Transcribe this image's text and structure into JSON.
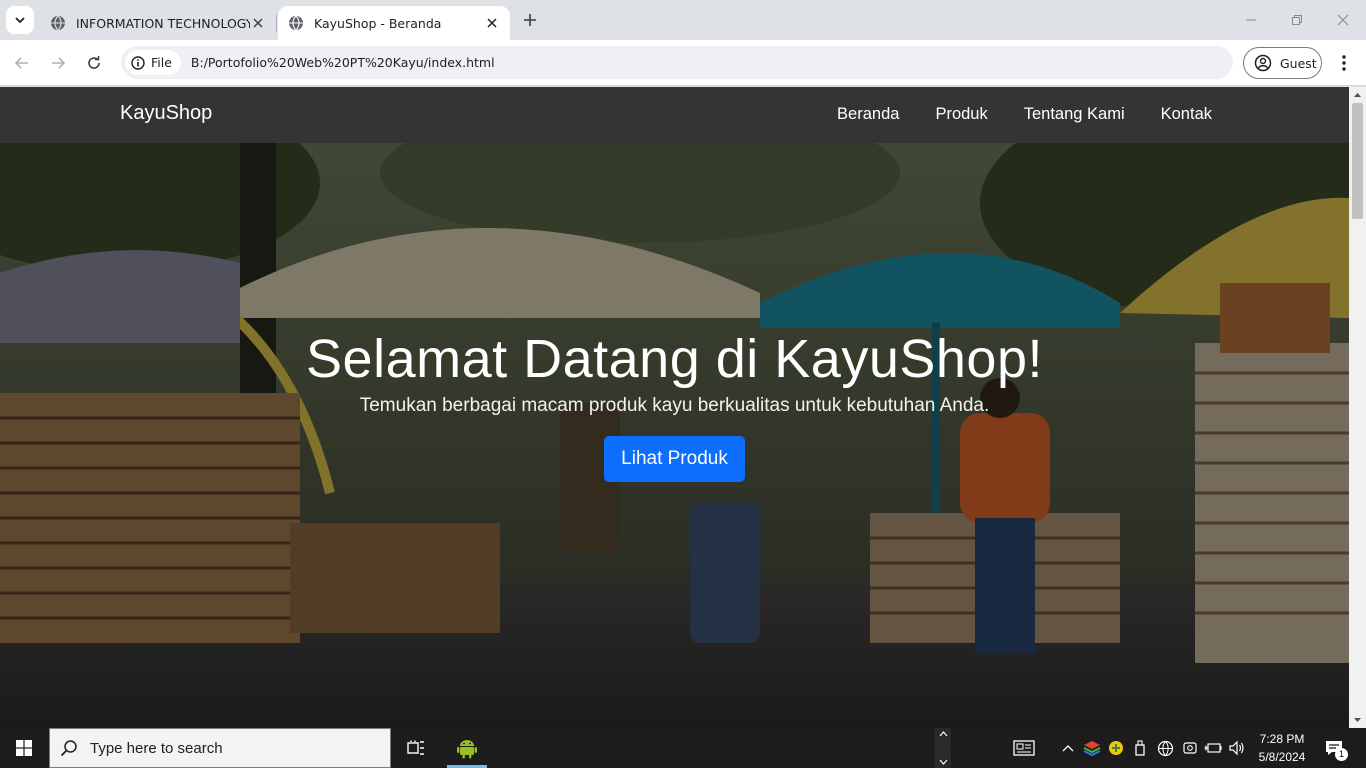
{
  "browser": {
    "tabs": [
      {
        "title": "INFORMATION TECHNOLOGY",
        "active": false
      },
      {
        "title": "KayuShop - Beranda",
        "active": true
      }
    ],
    "address": {
      "chip_label": "File",
      "url": "B:/Portofolio%20Web%20PT%20Kayu/index.html"
    },
    "profile_label": "Guest"
  },
  "site": {
    "brand": "KayuShop",
    "nav": [
      "Beranda",
      "Produk",
      "Tentang Kami",
      "Kontak"
    ],
    "hero": {
      "title": "Selamat Datang di KayuShop!",
      "subtitle": "Temukan berbagai macam produk kayu berkualitas untuk kebutuhan Anda.",
      "button": "Lihat Produk"
    },
    "colors": {
      "navbar": "#343434",
      "button": "#0d6efd"
    }
  },
  "taskbar": {
    "search_placeholder": "Type here to search",
    "time": "7:28 PM",
    "date": "5/8/2024",
    "notification_count": "1"
  }
}
